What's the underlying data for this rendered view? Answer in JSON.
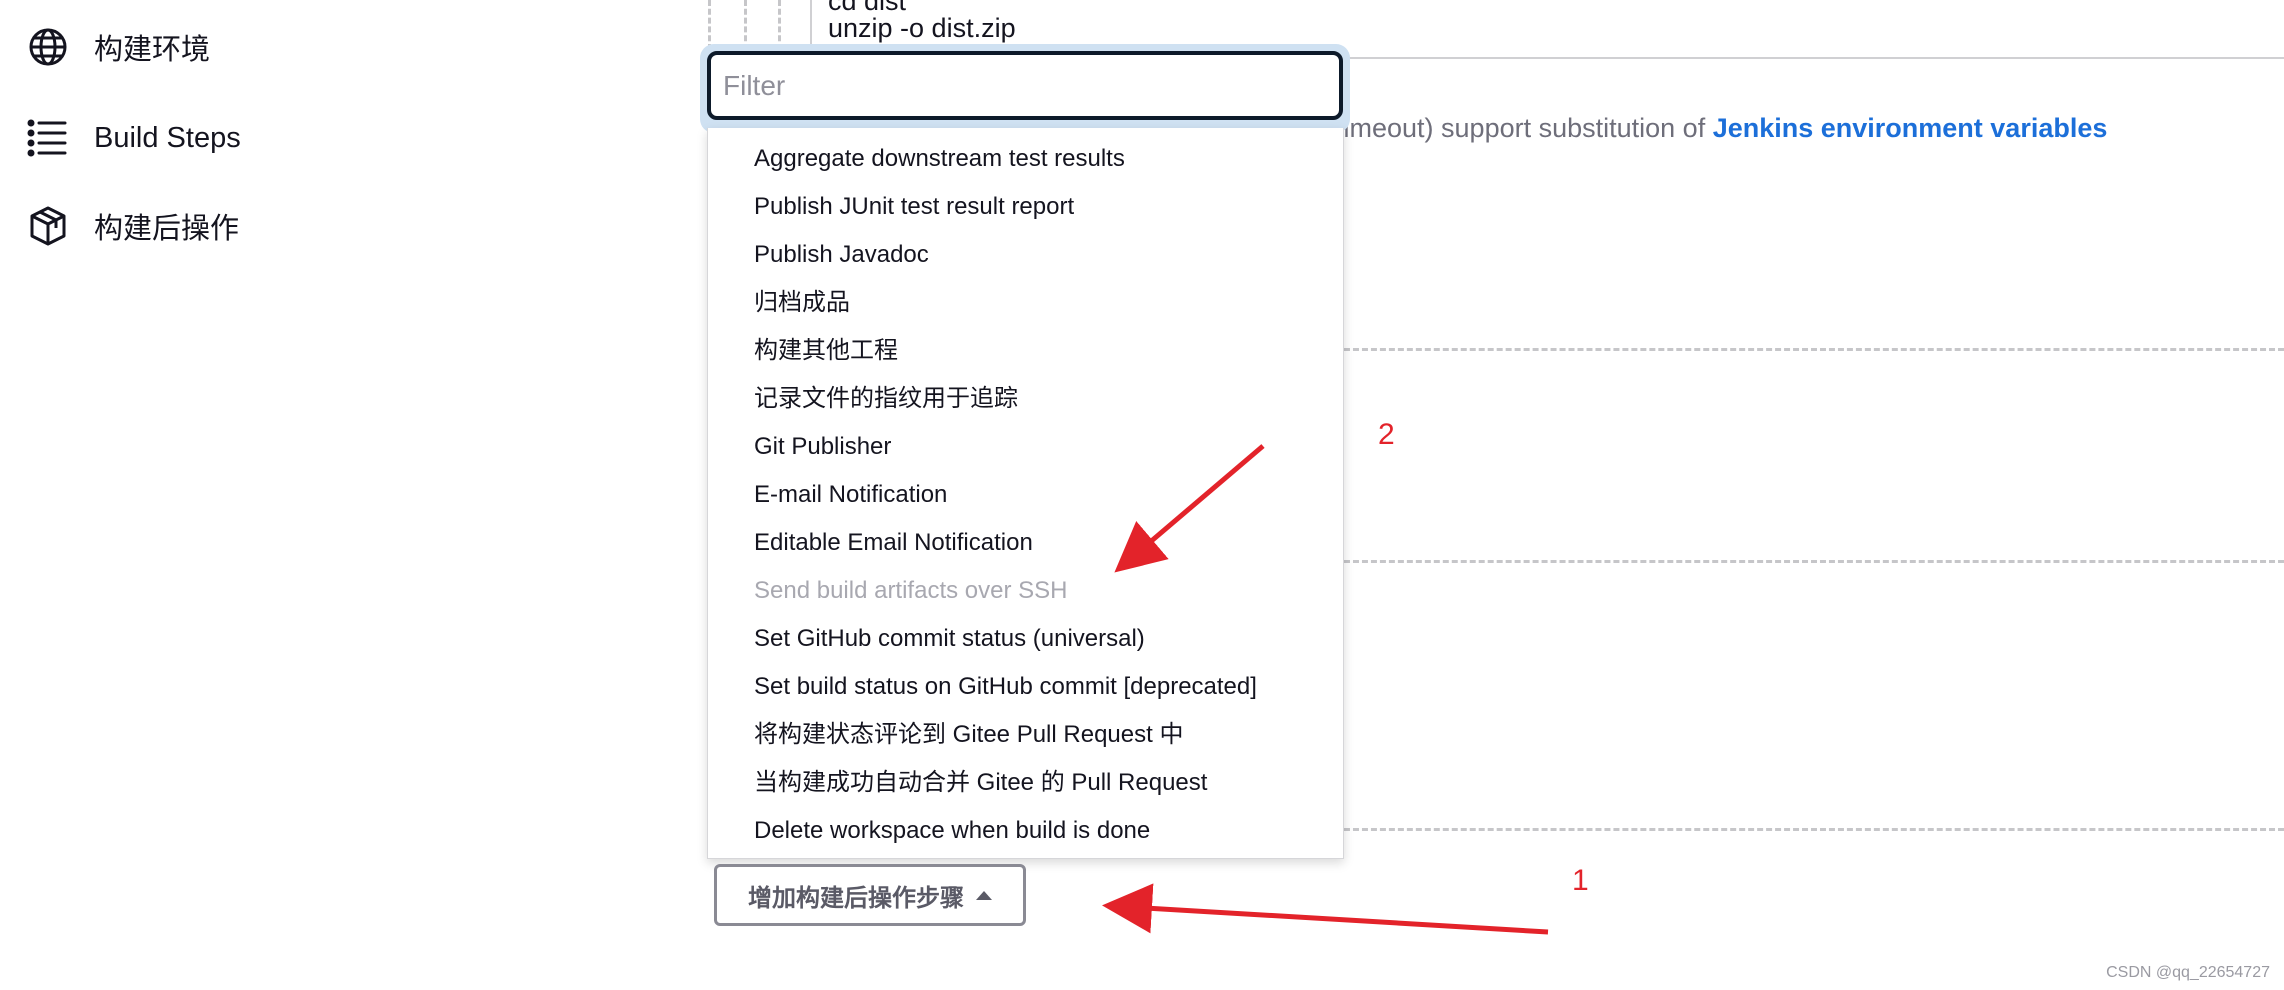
{
  "sidebar": {
    "items": [
      {
        "label": "构建环境",
        "icon": "globe-icon"
      },
      {
        "label": "Build Steps",
        "icon": "list-icon"
      },
      {
        "label": "构建后操作",
        "icon": "package-icon"
      }
    ]
  },
  "code": {
    "line1": "cd dist",
    "line2": "unzip -o dist.zip"
  },
  "note": {
    "text": "timeout) support substitution of ",
    "link": "Jenkins environment variables"
  },
  "filter": {
    "placeholder": "Filter",
    "value": ""
  },
  "menu": {
    "items": [
      {
        "label": "Aggregate downstream test results",
        "disabled": false
      },
      {
        "label": "Publish JUnit test result report",
        "disabled": false
      },
      {
        "label": "Publish Javadoc",
        "disabled": false
      },
      {
        "label": "归档成品",
        "disabled": false
      },
      {
        "label": "构建其他工程",
        "disabled": false
      },
      {
        "label": "记录文件的指纹用于追踪",
        "disabled": false
      },
      {
        "label": "Git Publisher",
        "disabled": false
      },
      {
        "label": "E-mail Notification",
        "disabled": false
      },
      {
        "label": "Editable Email Notification",
        "disabled": false
      },
      {
        "label": "Send build artifacts over SSH",
        "disabled": true
      },
      {
        "label": "Set GitHub commit status (universal)",
        "disabled": false
      },
      {
        "label": "Set build status on GitHub commit [deprecated]",
        "disabled": false
      },
      {
        "label": "将构建状态评论到 Gitee Pull Request 中",
        "disabled": false
      },
      {
        "label": "当构建成功自动合并 Gitee 的 Pull Request",
        "disabled": false
      },
      {
        "label": "Delete workspace when build is done",
        "disabled": false
      }
    ]
  },
  "add_button": {
    "label": "增加构建后操作步骤"
  },
  "annotations": {
    "one": "1",
    "two": "2",
    "color": "#e3232a"
  },
  "watermark": "CSDN @qq_22654727",
  "colors": {
    "link": "#1c6fd9",
    "focus_ring": "#cfe1f2",
    "annotation": "#e3232a"
  }
}
